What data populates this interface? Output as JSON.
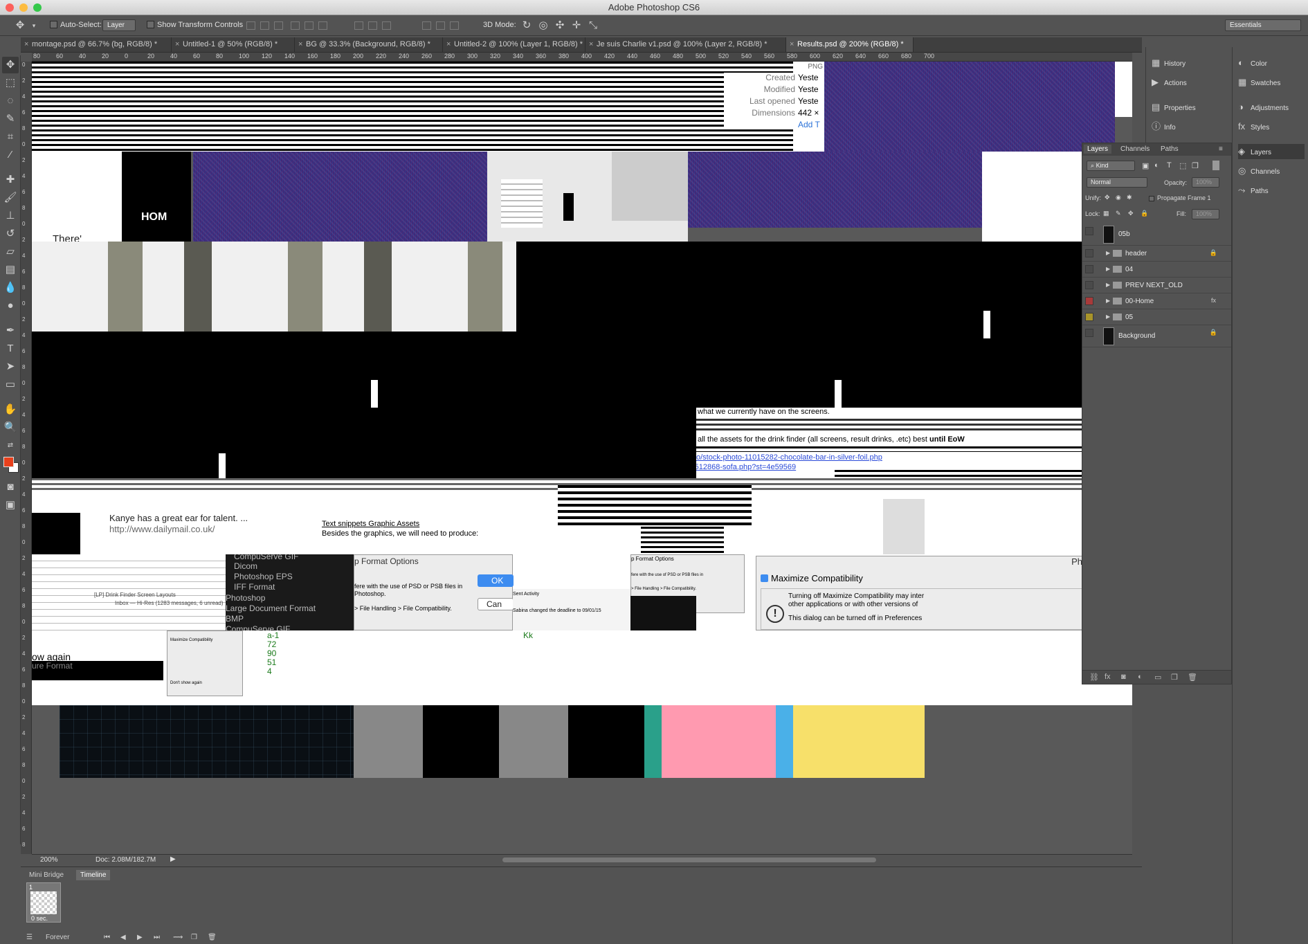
{
  "app": {
    "title": "Adobe Photoshop CS6"
  },
  "options_bar": {
    "auto_select_label": "Auto-Select:",
    "auto_select_value": "Layer",
    "show_transform_label": "Show Transform Controls",
    "mode_3d_label": "3D Mode:",
    "workspace": "Essentials"
  },
  "tabs": [
    {
      "label": "montage.psd @ 66.7% (bg, RGB/8) *"
    },
    {
      "label": "Untitled-1 @ 50% (RGB/8) *"
    },
    {
      "label": "BG @ 33.3% (Background, RGB/8) *"
    },
    {
      "label": "Untitled-2 @ 100% (Layer 1, RGB/8) *"
    },
    {
      "label": "Je suis Charlie v1.psd @ 100% (Layer 2, RGB/8) *"
    },
    {
      "label": "Results.psd @ 200% (RGB/8) *"
    }
  ],
  "ruler_top": [
    "80",
    "60",
    "40",
    "20",
    "0",
    "20",
    "40",
    "60",
    "80",
    "100",
    "120",
    "140",
    "160",
    "180",
    "200",
    "220",
    "240",
    "260",
    "280",
    "300",
    "320",
    "340",
    "360",
    "380",
    "400",
    "420",
    "440",
    "460",
    "480",
    "500",
    "520",
    "540",
    "560",
    "580",
    "600",
    "620",
    "640",
    "660",
    "680",
    "700"
  ],
  "ruler_left": [
    "0",
    "2",
    "4",
    "6",
    "8",
    "0",
    "2",
    "4",
    "6",
    "8",
    "0",
    "2",
    "4",
    "6",
    "8",
    "0",
    "2",
    "4",
    "6",
    "8",
    "0",
    "2",
    "4",
    "6",
    "8",
    "0",
    "2",
    "4",
    "6",
    "8",
    "0",
    "2",
    "4",
    "6",
    "8",
    "0",
    "2",
    "4",
    "6",
    "8",
    "0",
    "2",
    "4",
    "6",
    "8",
    "0",
    "2",
    "4",
    "6",
    "8"
  ],
  "canvas": {
    "file_info": {
      "type": "PNG",
      "created_label": "Created",
      "created_value": "Yeste",
      "modified_label": "Modified",
      "modified_value": "Yeste",
      "opened_label": "Last opened",
      "opened_value": "Yeste",
      "dimensions_label": "Dimensions",
      "dimensions_value": "442 ×",
      "add_tags": "Add T"
    },
    "hom_text": "HOM",
    "theres_text": "There'",
    "note1": "what we currently have on the screens.",
    "note2": "all the assets for the drink finder (all screens, result drinks, .etc) best",
    "note2_bold": "until EoW",
    "link1": "o/stock-photo-11015282-chocolate-bar-in-silver-foil.php",
    "link2": "-512868-sofa.php?st=4e59569",
    "kanye": "Kanye has a great ear for talent. ...",
    "dailymail": "http://www.dailymail.co.uk/",
    "snippets": "Text snippets Graphic Assets",
    "besides": "Besides the graphics, we will need to produce:",
    "formats": [
      "CompuServe GIF",
      "Dicom",
      "Photoshop EPS",
      "IFF Format",
      "Photoshop",
      "Large Document Format",
      "BMP",
      "CompuServe GIF"
    ],
    "format_options": "p Format Options",
    "format_options2": "p Format Options",
    "ok_label": "OK",
    "cancel_label": "Can",
    "interfere": "fere with the use of PSD or PSB files in",
    "photoshop_line": "Photoshop.",
    "file_handling": "> File Handling > File Compatibility.",
    "maximize_title": "Photosho",
    "maximize_label": "Maximize Compatibility",
    "maximize_text1": "Turning off Maximize Compatibility may inter",
    "maximize_text2": "other applications or with other versions of",
    "maximize_text3": "This dialog can be turned off in Preferences",
    "show_again": "ow again",
    "ure_format": "ure Format",
    "dont_show": "Don't show again",
    "numbers": [
      "a-1",
      "72",
      "90",
      "51",
      "4"
    ],
    "inbox": "Inbox — Hi-Res (1283 messages, 6 unread)",
    "drink_finder": "[LP] Drink Finder Screen Layouts",
    "sent_activity": "Sent Activity",
    "sabina": "Sabina changed the deadline to 09/01/15",
    "kk": "Kk"
  },
  "status": {
    "zoom": "200%",
    "doc": "Doc: 2.08M/182.7M"
  },
  "bottom_panel": {
    "tabs": [
      "Mini Bridge",
      "Timeline"
    ],
    "frame_index": "1",
    "frame_delay": "0 sec.",
    "loop": "Forever"
  },
  "panel_icons_left": [
    "History",
    "Actions",
    "Properties",
    "Info"
  ],
  "panel_icons_right": [
    "Color",
    "Swatches",
    "Adjustments",
    "Styles",
    "Layers",
    "Channels",
    "Paths"
  ],
  "layers_panel": {
    "tabs": [
      "Layers",
      "Channels",
      "Paths"
    ],
    "kind": "Kind",
    "blend": "Normal",
    "opacity_label": "Opacity:",
    "opacity_value": "100%",
    "unify_label": "Unify:",
    "propagate": "Propagate Frame 1",
    "lock_label": "Lock:",
    "fill_label": "Fill:",
    "fill_value": "100%",
    "layers": [
      {
        "name": "05b",
        "kind": "thumb"
      },
      {
        "name": "header",
        "kind": "group",
        "locked": true
      },
      {
        "name": "04",
        "kind": "group"
      },
      {
        "name": "PREV NEXT_OLD",
        "kind": "group"
      },
      {
        "name": "00-Home",
        "kind": "group",
        "fx": "fx",
        "color": "#a83a3a"
      },
      {
        "name": "05",
        "kind": "group",
        "color": "#a8942a"
      },
      {
        "name": "Background",
        "kind": "bg",
        "locked": true
      }
    ]
  },
  "colors": {
    "foreground": "#e8401c",
    "background": "#ffffff"
  }
}
